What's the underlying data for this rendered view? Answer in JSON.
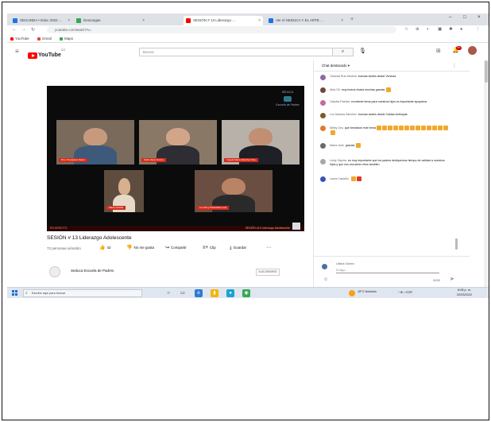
{
  "browser": {
    "tabs": [
      {
        "title": "SEGUNDA • Educ 2022 ...",
        "favicon_color": "#1a73e8",
        "active": false
      },
      {
        "title": "Descargas",
        "favicon_color": "#34a853",
        "active": false
      },
      {
        "title": "SESIÓN # 13 Liderazgo ...",
        "favicon_color": "#ff0000",
        "active": true
      },
      {
        "title": "Ver el SEDUCA Y EL ARTE ...",
        "favicon_color": "#1a73e8",
        "active": false
      }
    ],
    "new_tab": "+",
    "window_controls": [
      "–",
      "□",
      "×"
    ],
    "url": "youtube.com/watch?v=",
    "bookmarks": [
      {
        "label": "YouTube",
        "color": "#ff0000"
      },
      {
        "label": "Gmail",
        "color": "#ea4335"
      },
      {
        "label": "Maps",
        "color": "#34a853"
      }
    ]
  },
  "youtube": {
    "logo_text": "YouTube",
    "logo_country": "CO",
    "search_placeholder": "Buscar",
    "notification_count": "9+"
  },
  "video": {
    "participants": [
      {
        "name": "Dra. Prestadora Salud"
      },
      {
        "name": "Sofía Vaca Orozco"
      },
      {
        "name": "Angela María Sánchez Toro"
      },
      {
        "name": "Marta Giraldo"
      },
      {
        "name": "Luz Mery Piedrahita Luna"
      }
    ],
    "brand_line1": "SEDUCA",
    "brand_line2": "Escuela de Padres",
    "lower_left": "EN DIRECTO",
    "lower_right": "SESIÓN #13 Liderazgo Adolescente",
    "title": "SESIÓN # 13 Liderazgo Adolescente",
    "meta": "72 personas viéndolo",
    "actions": [
      {
        "icon": "👍",
        "label": "42"
      },
      {
        "icon": "👎",
        "label": "No me gusta"
      },
      {
        "icon": "↪",
        "label": "Compartir"
      },
      {
        "icon": "≡+",
        "label": "Clip"
      },
      {
        "icon": "⤓",
        "label": "Guardar"
      },
      {
        "icon": "⋯",
        "label": ""
      }
    ],
    "channel_name": "Seduca Escuela de Padres",
    "subscribe": "SUSCRIBIRSE"
  },
  "chat": {
    "header": "Chat destacado",
    "messages": [
      {
        "author": "Yolanda Ruiz Medina",
        "text": "buenas tardes desde Venecia",
        "avatar_color": "#8e6b9c",
        "emoji": 0
      },
      {
        "author": "Aida Gil",
        "text": "muy buena charla muchas gracias",
        "avatar_color": "#6b4a3a",
        "emoji": 1
      },
      {
        "author": "Claudia Patricia",
        "text": "excelente tema para nuestros hijos es importante apoyarlos",
        "avatar_color": "#c46a9e",
        "emoji": 0
      },
      {
        "author": "Luz Adriana Sánchez",
        "text": "buenas tardes desde Caldas Antioquia",
        "avatar_color": "#7a5a2e",
        "emoji": 0
      },
      {
        "author": "Mirley Zea",
        "text": "que bendición este tema",
        "avatar_color": "#e07b2a",
        "emoji": 14
      },
      {
        "author": "María José",
        "text": "gracias",
        "avatar_color": "#6a6a6a",
        "emoji": 1
      },
      {
        "author": "Leidy Ospina",
        "text": "es muy importante que los padres dediquemos tiempo de calidad a nuestros hijos y que nos escuchen ellos también",
        "avatar_color": "#a8a8a8",
        "emoji": 0
      },
      {
        "author": "Laura Castaño",
        "text": "",
        "avatar_color": "#3f51b5",
        "emoji": 2
      }
    ],
    "input_name": "Liliana Gómez",
    "input_placeholder": "Di algo...",
    "char_count": "0/200"
  },
  "taskbar": {
    "search_placeholder": "Escribe aquí para buscar",
    "apps": [
      {
        "icon": "○",
        "bg": "transparent",
        "fg": "#222"
      },
      {
        "icon": "▭",
        "bg": "transparent",
        "fg": "#222"
      },
      {
        "icon": "e",
        "bg": "#2b7cd3",
        "fg": "#fff"
      },
      {
        "icon": "▮",
        "bg": "#f6b400",
        "fg": "#fff"
      },
      {
        "icon": "●",
        "bg": "#1aa3d4",
        "fg": "#fff"
      },
      {
        "icon": "◉",
        "bg": "#34a853",
        "fg": "#fff"
      }
    ],
    "weather": "18°C  Nublado",
    "tray": "^  ⊕  ⌂  ESP",
    "time": "6:08 p. m.",
    "date": "22/03/2022"
  }
}
